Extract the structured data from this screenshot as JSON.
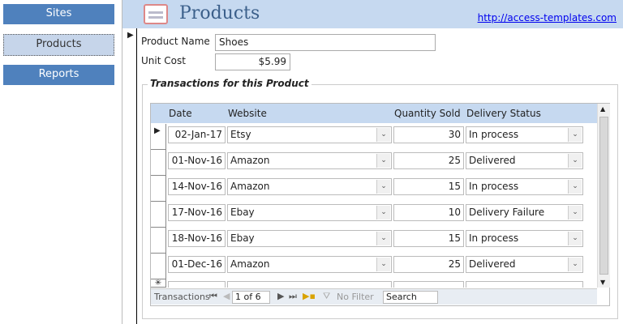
{
  "sidebar": {
    "items": [
      {
        "label": "Sites"
      },
      {
        "label": "Products",
        "selected": true
      },
      {
        "label": "Reports"
      }
    ]
  },
  "header": {
    "title": "Products",
    "link": "http://access-templates.com",
    "icon": "form-icon"
  },
  "form": {
    "product_name_label": "Product Name",
    "product_name": "Shoes",
    "unit_cost_label": "Unit Cost",
    "unit_cost": "$5.99"
  },
  "subform": {
    "title": "Transactions for this Product",
    "columns": [
      "Date",
      "Website",
      "Quantity Sold",
      "Delivery Status"
    ],
    "rows": [
      {
        "date": "02-Jan-17",
        "website": "Etsy",
        "qty": "30",
        "status": "In process"
      },
      {
        "date": "01-Nov-16",
        "website": "Amazon",
        "qty": "25",
        "status": "Delivered"
      },
      {
        "date": "14-Nov-16",
        "website": "Amazon",
        "qty": "15",
        "status": "In process"
      },
      {
        "date": "17-Nov-16",
        "website": "Ebay",
        "qty": "10",
        "status": "Delivery Failure"
      },
      {
        "date": "18-Nov-16",
        "website": "Ebay",
        "qty": "15",
        "status": "In process"
      },
      {
        "date": "01-Dec-16",
        "website": "Amazon",
        "qty": "25",
        "status": "Delivered"
      }
    ],
    "new_row_marker": "✳",
    "nav": {
      "label": "Transactions",
      "record": "1 of 6",
      "filter": "No Filter",
      "search": "Search"
    }
  }
}
